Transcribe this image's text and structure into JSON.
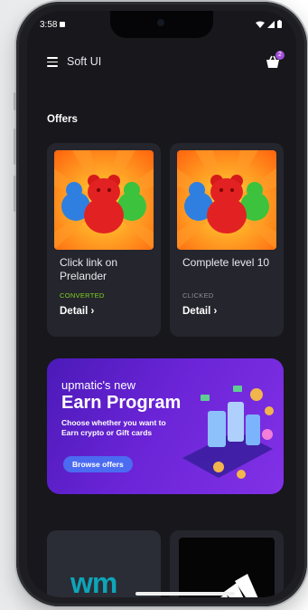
{
  "status_bar": {
    "time": "3:58"
  },
  "app_bar": {
    "title": "Soft UI",
    "cart_count": "2"
  },
  "offers": {
    "section_title": "Offers",
    "cards": [
      {
        "title": "Click link on Prelander",
        "status": "CONVERTED",
        "status_color": "#7ed321",
        "detail_label": "Detail ›"
      },
      {
        "title": "Complete level 10",
        "status": "CLICKED",
        "status_color": "#8e8e98",
        "detail_label": "Detail ›"
      }
    ]
  },
  "banner": {
    "line1": "upmatic's new",
    "line2": "Earn Program",
    "line3": "Choose whether you want to Earn crypto or Gift cards",
    "button_label": "Browse offers"
  },
  "bottom_cards": [
    {
      "logo_text": "wm"
    },
    {
      "logo_icon": "adidas-logo-icon"
    }
  ],
  "colors": {
    "accent_purple": "#6a24d6",
    "converted_green": "#7ed321",
    "badge_purple": "#a24fd8"
  }
}
